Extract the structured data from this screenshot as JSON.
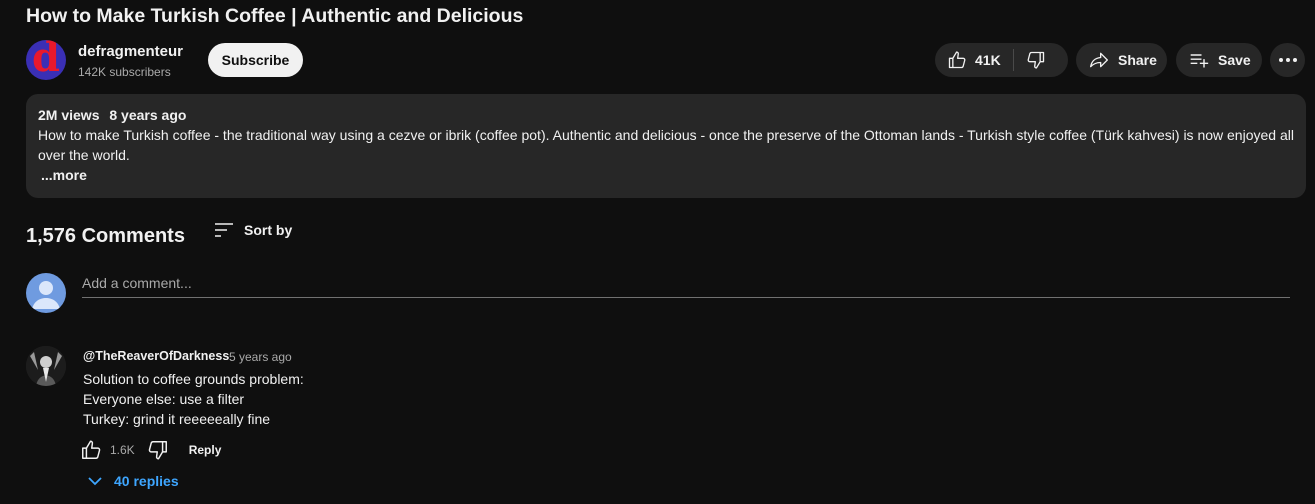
{
  "video": {
    "title": "How to Make Turkish Coffee | Authentic and Delicious"
  },
  "channel": {
    "avatar_letter": "d",
    "name": "defragmenteur",
    "subscribers": "142K subscribers",
    "subscribe_label": "Subscribe"
  },
  "actions": {
    "like_count": "41K",
    "share_label": "Share",
    "save_label": "Save"
  },
  "description": {
    "views": "2M views",
    "age": "8 years ago",
    "text": "How to make Turkish coffee - the traditional way using a cezve or ibrik (coffee pot). Authentic and delicious - once the preserve of the Ottoman lands - Turkish style coffee (Türk kahvesi) is now enjoyed all over the world.",
    "more_label": "...more"
  },
  "comments": {
    "count_label": "1,576 Comments",
    "sort_label": "Sort by",
    "add_placeholder": "Add a comment...",
    "items": [
      {
        "author": "@TheReaverOfDarkness",
        "time": "5 years ago",
        "lines": [
          "Solution to coffee grounds problem:",
          "Everyone else: use a filter",
          "Turkey: grind it reeeeeally fine"
        ],
        "likes": "1.6K",
        "reply_label": "Reply",
        "replies_label": "40 replies"
      }
    ]
  },
  "colors": {
    "background": "#0f0f0f",
    "panel": "#272727",
    "link_blue": "#3ea6ff",
    "channel_avatar_bg": "#3a2fb5",
    "channel_avatar_letter": "#e8192c"
  },
  "icons": [
    "like-icon",
    "dislike-icon",
    "share-icon",
    "save-playlist-icon",
    "more-horizontal-icon",
    "sort-icon",
    "user-avatar-icon",
    "chevron-down-icon"
  ]
}
